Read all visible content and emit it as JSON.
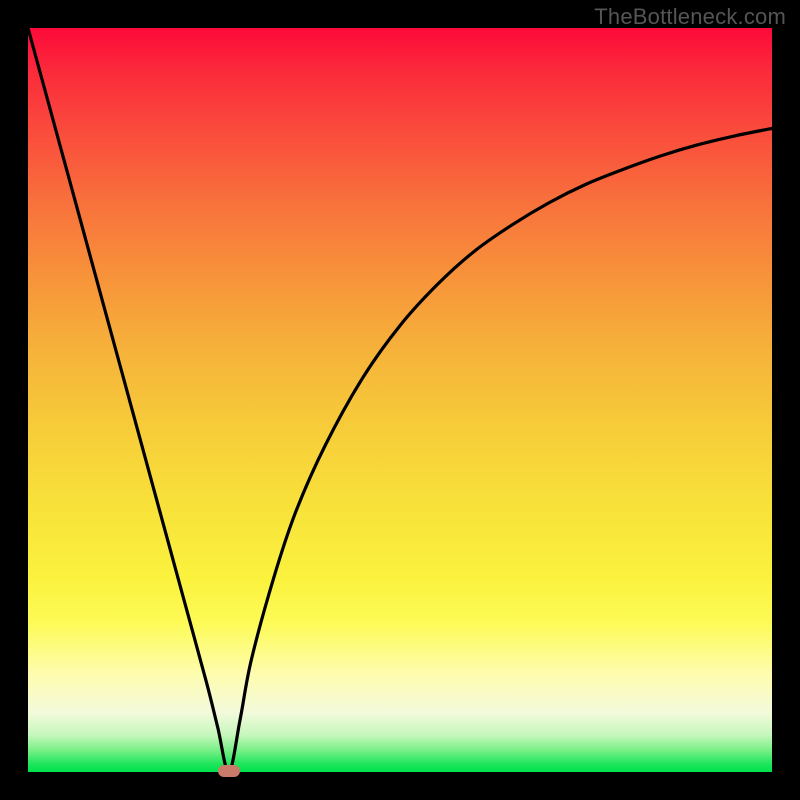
{
  "watermark": "TheBottleneck.com",
  "colors": {
    "frame": "#000000",
    "curve": "#000000",
    "marker": "#cb7b6a",
    "gradient_top": "#fc0a3a",
    "gradient_bottom": "#00e14b"
  },
  "chart_data": {
    "type": "line",
    "title": "",
    "xlabel": "",
    "ylabel": "",
    "xlim": [
      0,
      100
    ],
    "ylim": [
      0,
      100
    ],
    "annotations": [
      {
        "kind": "marker",
        "x": 27,
        "y": 0,
        "shape": "rounded-rect",
        "color": "#cb7b6a"
      }
    ],
    "series": [
      {
        "name": "bottleneck-curve",
        "x": [
          0,
          3,
          6,
          9,
          12,
          15,
          18,
          21,
          24,
          25.5,
          27,
          28.5,
          30,
          33,
          36,
          40,
          45,
          50,
          55,
          60,
          65,
          70,
          75,
          80,
          85,
          90,
          95,
          100
        ],
        "y": [
          100,
          89,
          78,
          67,
          56,
          45,
          34,
          23,
          12,
          6,
          0,
          7,
          15,
          26,
          35,
          44,
          53,
          60,
          65.5,
          70,
          73.5,
          76.5,
          79,
          81,
          82.8,
          84.3,
          85.5,
          86.5
        ]
      }
    ]
  }
}
